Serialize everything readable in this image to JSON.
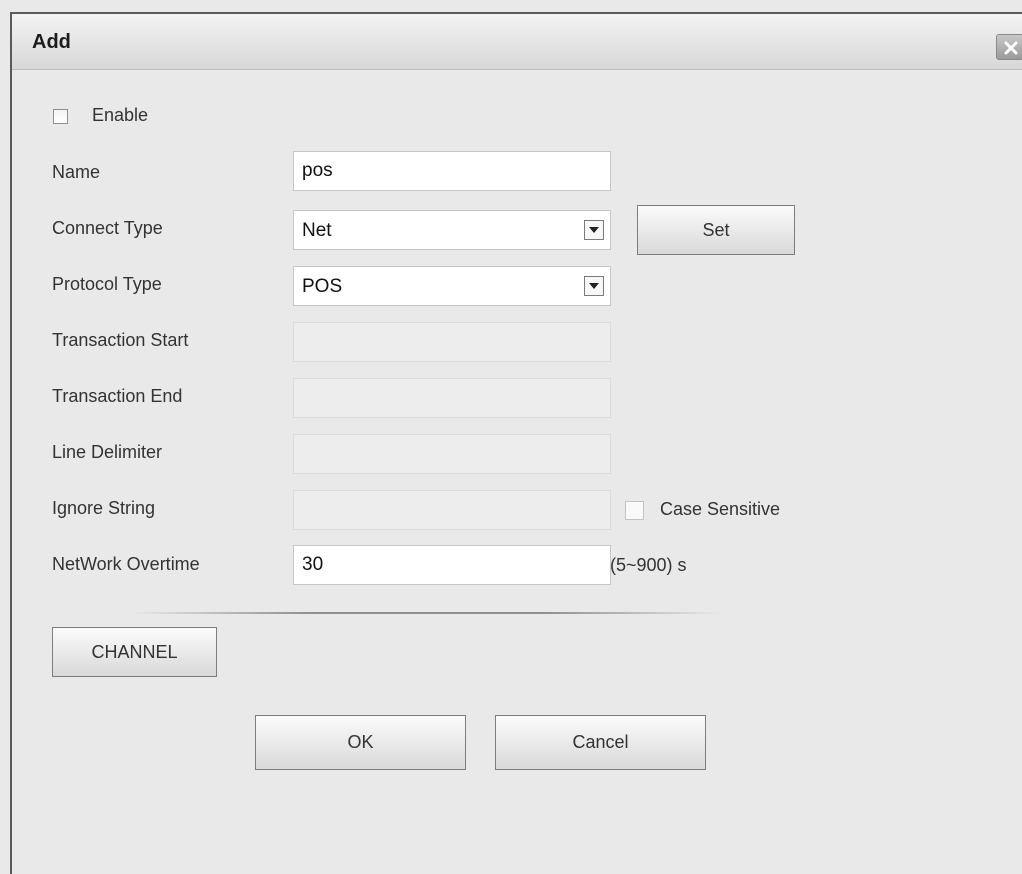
{
  "dialog": {
    "title": "Add",
    "close_icon": "close-icon"
  },
  "form": {
    "enable": {
      "label": "Enable",
      "checked": false
    },
    "name": {
      "label": "Name",
      "value": "pos"
    },
    "connect_type": {
      "label": "Connect Type",
      "value": "Net",
      "set_label": "Set"
    },
    "protocol_type": {
      "label": "Protocol Type",
      "value": "POS"
    },
    "transaction_start": {
      "label": "Transaction Start",
      "value": ""
    },
    "transaction_end": {
      "label": "Transaction End",
      "value": ""
    },
    "line_delimiter": {
      "label": "Line Delimiter",
      "value": ""
    },
    "ignore_string": {
      "label": "Ignore String",
      "value": "",
      "case_sensitive_label": "Case Sensitive",
      "case_sensitive_checked": false
    },
    "network_overtime": {
      "label": "NetWork Overtime",
      "value": "30",
      "unit": "(5~900) s"
    }
  },
  "buttons": {
    "channel": "CHANNEL",
    "ok": "OK",
    "cancel": "Cancel"
  }
}
